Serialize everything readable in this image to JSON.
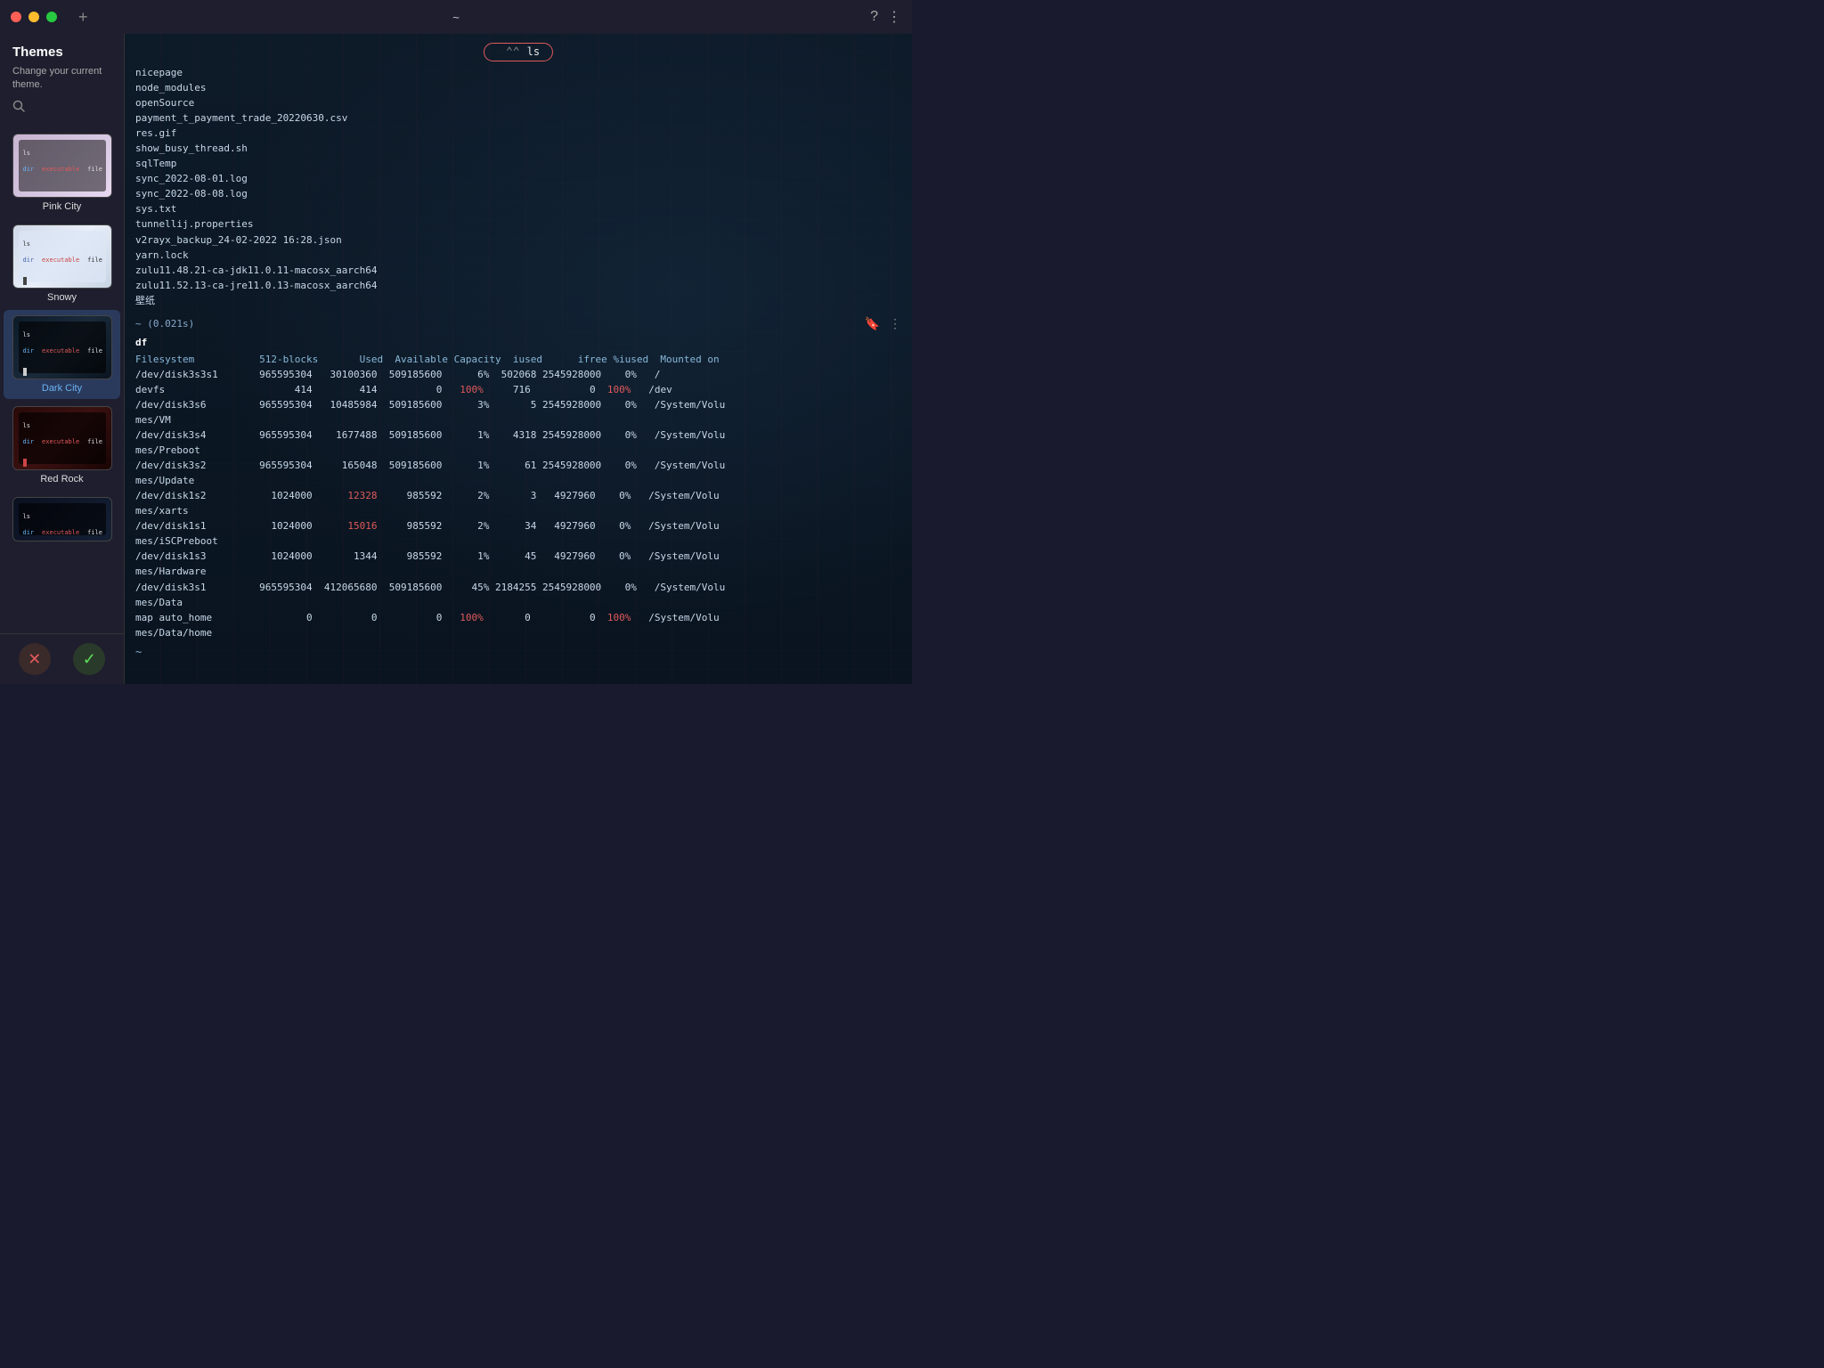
{
  "titlebar": {
    "title": "~",
    "plus_label": "+",
    "help_icon": "?",
    "menu_icon": "⋮"
  },
  "sidebar": {
    "title": "Themes",
    "subtitle": "Change your current theme.",
    "themes": [
      {
        "id": "pink-city",
        "name": "Pink City",
        "active": false,
        "preview_class": "preview-pink"
      },
      {
        "id": "snowy",
        "name": "Snowy",
        "active": false,
        "preview_class": "preview-snowy"
      },
      {
        "id": "dark-city",
        "name": "Dark City",
        "active": true,
        "preview_class": "preview-dark"
      },
      {
        "id": "red-rock",
        "name": "Red Rock",
        "active": false,
        "preview_class": "preview-red"
      },
      {
        "id": "theme-5",
        "name": "",
        "active": false,
        "preview_class": "preview-blue"
      }
    ],
    "cancel_label": "✕",
    "confirm_label": "✓"
  },
  "terminal": {
    "ls_files": [
      "nicepage",
      "node_modules",
      "openSource",
      "payment_t_payment_trade_20220630.csv",
      "res.gif",
      "show_busy_thread.sh",
      "sqlTemp",
      "sync_2022-08-01.log",
      "sync_2022-08-08.log",
      "sys.txt",
      "tunnellij.properties",
      "v2rayx_backup_24-02-2022 16:28.json",
      "yarn.lock",
      "zulu11.48.21-ca-jdk11.0.11-macosx_aarch64",
      "zulu11.52.13-ca-jre11.0.13-macosx_aarch64",
      "壁纸"
    ],
    "df_prompt": "~ (0.021s)",
    "df_cmd": "df",
    "df_headers": "Filesystem           512-blocks       Used  Available Capacity  iused      ifree %iused  Mounted on",
    "df_rows": [
      {
        "fs": "/dev/disk3s3s1",
        "blocks": "965595304",
        "used": "30100360",
        "avail": "509185600",
        "cap": "6%",
        "iused": "502068",
        "ifree": "2545928000",
        "piused": "0%",
        "mount": "/"
      },
      {
        "fs": "devfs",
        "blocks": "414",
        "used": "414",
        "avail": "0",
        "cap": "100%",
        "iused": "716",
        "ifree": "0",
        "piused": "100%",
        "mount": "/dev"
      },
      {
        "fs": "/dev/disk3s6",
        "blocks": "965595304",
        "used": "10485984",
        "avail": "509185600",
        "cap": "3%",
        "iused": "5",
        "ifree": "2545928000",
        "piused": "0%",
        "mount": "/System/Volumes/VM"
      },
      {
        "fs": "/dev/disk3s4",
        "blocks": "965595304",
        "used": "1677488",
        "avail": "509185600",
        "cap": "1%",
        "iused": "4318",
        "ifree": "2545928000",
        "piused": "0%",
        "mount": "/System/Volumes/Preboot"
      },
      {
        "fs": "/dev/disk3s2",
        "blocks": "965595304",
        "used": "165048",
        "avail": "509185600",
        "cap": "1%",
        "iused": "61",
        "ifree": "2545928000",
        "piused": "0%",
        "mount": "/System/Volumes/Update"
      },
      {
        "fs": "/dev/disk1s2",
        "blocks": "1024000",
        "used": "12328",
        "avail": "985592",
        "cap": "2%",
        "iused": "3",
        "ifree": "4927960",
        "piused": "0%",
        "mount": "/System/Volumes/xarts"
      },
      {
        "fs": "/dev/disk1s1",
        "blocks": "1024000",
        "used": "15016",
        "avail": "985592",
        "cap": "2%",
        "iused": "34",
        "ifree": "4927960",
        "piused": "0%",
        "mount": "/System/Volumes/iSCPreboot"
      },
      {
        "fs": "/dev/disk1s3",
        "blocks": "1024000",
        "used": "1344",
        "avail": "985592",
        "cap": "1%",
        "iused": "45",
        "ifree": "4927960",
        "piused": "0%",
        "mount": "/System/Volumes/Hardware"
      },
      {
        "fs": "/dev/disk3s1",
        "blocks": "965595304",
        "used": "412065680",
        "avail": "509185600",
        "cap": "45%",
        "iused": "2184255",
        "ifree": "2545928000",
        "piused": "0%",
        "mount": "/System/Volumes/Data"
      },
      {
        "fs": "map auto_home",
        "blocks": "0",
        "used": "0",
        "avail": "0",
        "cap": "100%",
        "iused": "0",
        "ifree": "0",
        "piused": "100%",
        "mount": "/System/Volumes/Data/home"
      }
    ],
    "final_prompt": "~"
  }
}
